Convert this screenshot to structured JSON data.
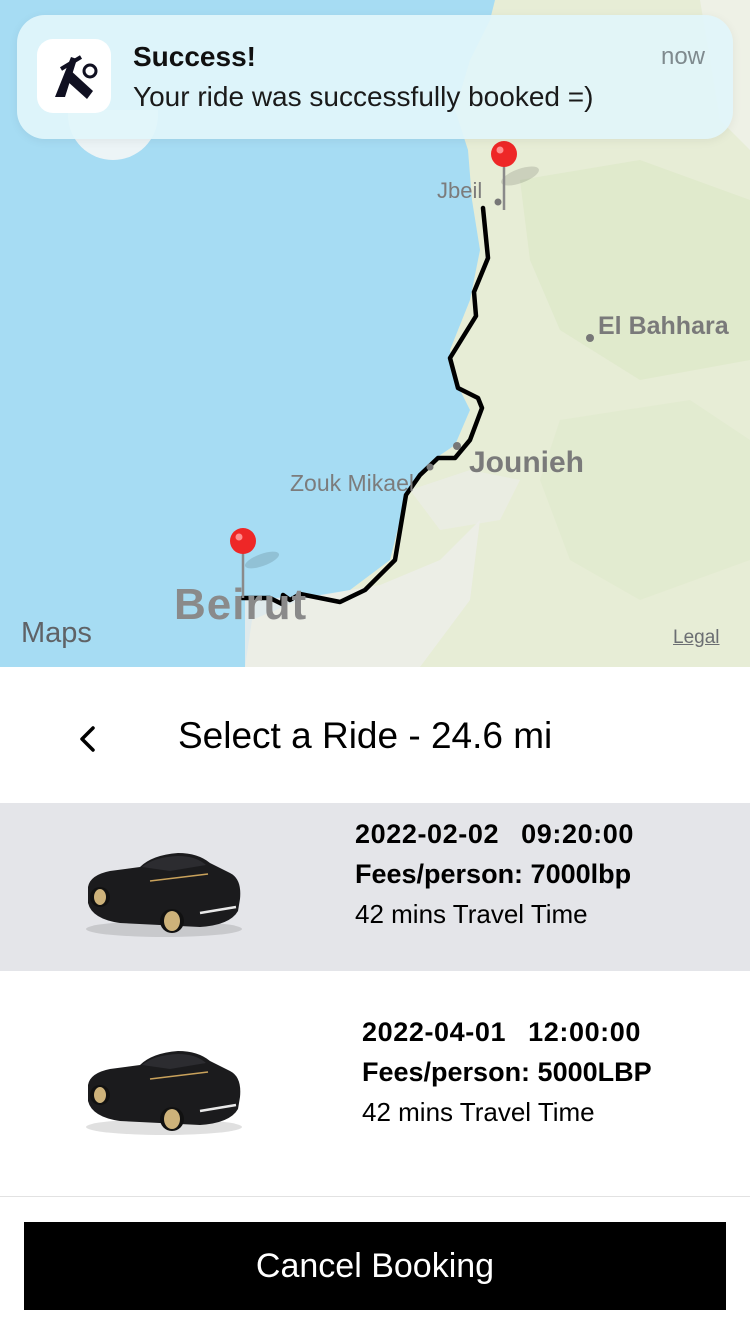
{
  "notification": {
    "title": "Success!",
    "body": "Your ride was successfully booked =)",
    "time": "now",
    "app_icon": "app-logo-icon"
  },
  "map": {
    "labels": {
      "beirut": "Beirut",
      "jbeil": "Jbeil",
      "el_bahhara": "El Bahhara",
      "jounieh": "Jounieh",
      "zouk_mikael": "Zouk Mikael"
    },
    "brand": "Maps",
    "legal": "Legal",
    "colors": {
      "sea": "#a5dbf2",
      "land": "#e9efd9",
      "route": "#000000",
      "pin": "#ef2a2a"
    }
  },
  "header": {
    "title": "Select a Ride - 24.6 mi",
    "back_icon": "chevron-left-icon"
  },
  "rides": [
    {
      "date": "2022-02-02",
      "time": "09:20:00",
      "fees": "Fees/person: 7000lbp",
      "travel": "42 mins Travel Time",
      "selected": true
    },
    {
      "date": "2022-04-01",
      "time": "12:00:00",
      "fees": "Fees/person: 5000LBP",
      "travel": "42 mins Travel Time",
      "selected": false
    }
  ],
  "footer": {
    "cancel_label": "Cancel Booking"
  }
}
